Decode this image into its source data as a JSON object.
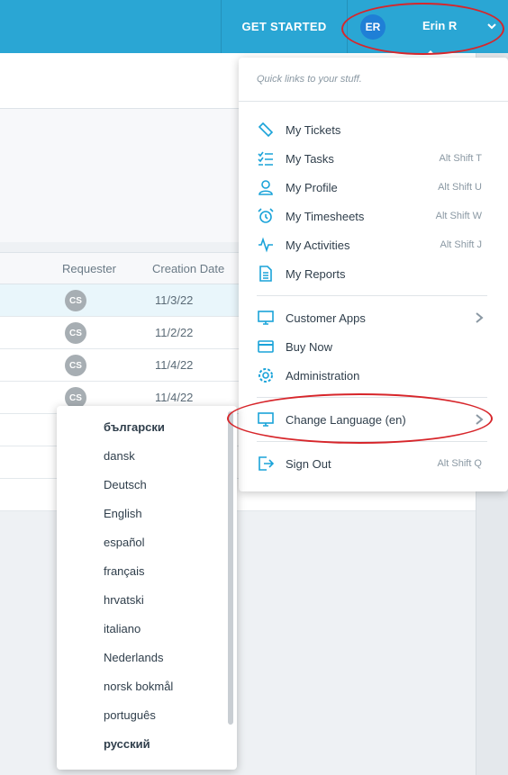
{
  "header": {
    "get_started": "GET STARTED",
    "avatar_initials": "ER",
    "user_name": "Erin R"
  },
  "table": {
    "columns": [
      "Requester",
      "Creation Date"
    ],
    "rows": [
      {
        "requester": "CS",
        "date": "11/3/22"
      },
      {
        "requester": "CS",
        "date": "11/2/22"
      },
      {
        "requester": "CS",
        "date": "11/4/22"
      },
      {
        "requester": "CS",
        "date": "11/4/22"
      }
    ]
  },
  "menu": {
    "header": "Quick links to your stuff.",
    "items": [
      {
        "label": "My Tickets",
        "shortcut": "",
        "icon": "ticket-icon"
      },
      {
        "label": "My Tasks",
        "shortcut": "Alt Shift T",
        "icon": "tasks-icon"
      },
      {
        "label": "My Profile",
        "shortcut": "Alt Shift U",
        "icon": "profile-icon"
      },
      {
        "label": "My Timesheets",
        "shortcut": "Alt Shift W",
        "icon": "alarm-clock-icon"
      },
      {
        "label": "My Activities",
        "shortcut": "Alt Shift J",
        "icon": "activity-icon"
      },
      {
        "label": "My Reports",
        "shortcut": "",
        "icon": "report-icon"
      },
      {
        "label": "Customer Apps",
        "shortcut": "",
        "icon": "monitor-icon"
      },
      {
        "label": "Buy Now",
        "shortcut": "",
        "icon": "credit-card-icon"
      },
      {
        "label": "Administration",
        "shortcut": "",
        "icon": "gear-icon"
      },
      {
        "label": "Change Language (en)",
        "shortcut": "",
        "icon": "monitor-icon"
      },
      {
        "label": "Sign Out",
        "shortcut": "Alt Shift Q",
        "icon": "sign-out-icon"
      }
    ]
  },
  "languages": [
    "български",
    "dansk",
    "Deutsch",
    "English",
    "español",
    "français",
    "hrvatski",
    "italiano",
    "Nederlands",
    "norsk bokmål",
    "português",
    "русский"
  ],
  "colors": {
    "topbar": "#2aa6d4",
    "accent_icon": "#1aa3d9",
    "annotation_red": "#d7262b"
  }
}
